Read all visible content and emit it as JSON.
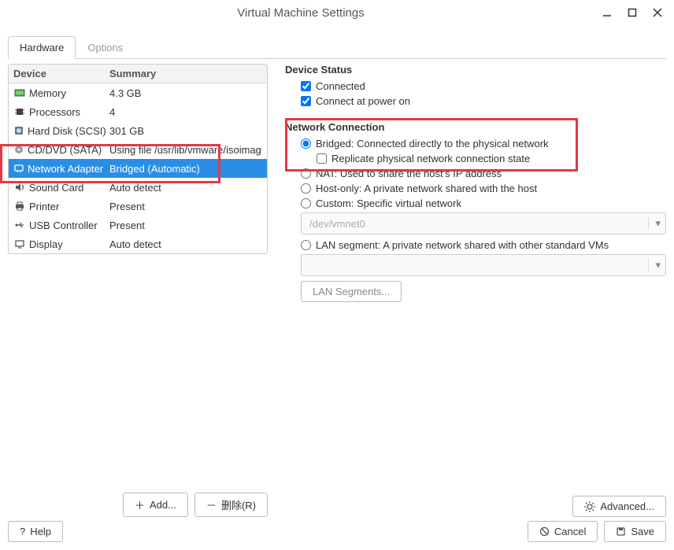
{
  "window": {
    "title": "Virtual Machine Settings"
  },
  "tabs": {
    "hardware": "Hardware",
    "options": "Options"
  },
  "columns": {
    "device": "Device",
    "summary": "Summary"
  },
  "devices": {
    "memory": {
      "name": "Memory",
      "summary": "4.3 GB"
    },
    "processors": {
      "name": "Processors",
      "summary": "4"
    },
    "harddisk": {
      "name": "Hard Disk (SCSI)",
      "summary": "301 GB"
    },
    "cddvd": {
      "name": "CD/DVD (SATA)",
      "summary": "Using file /usr/lib/vmware/isoimag"
    },
    "netadapter": {
      "name": "Network Adapter",
      "summary": "Bridged (Automatic)"
    },
    "soundcard": {
      "name": "Sound Card",
      "summary": "Auto detect"
    },
    "printer": {
      "name": "Printer",
      "summary": "Present"
    },
    "usb": {
      "name": "USB Controller",
      "summary": "Present"
    },
    "display": {
      "name": "Display",
      "summary": "Auto detect"
    }
  },
  "leftButtons": {
    "add": "Add...",
    "remove": "删除(R)"
  },
  "status": {
    "title": "Device Status",
    "connected": "Connected",
    "connectPowerOn": "Connect at power on"
  },
  "netconn": {
    "title": "Network Connection",
    "bridged": "Bridged: Connected directly to the physical network",
    "replicate": "Replicate physical network connection state",
    "nat": "NAT: Used to share the host's IP address",
    "hostonly": "Host-only: A private network shared with the host",
    "custom": "Custom: Specific virtual network",
    "customValue": "/dev/vmnet0",
    "lan": "LAN segment: A private network shared with other standard VMs",
    "lanSegmentsBtn": "LAN Segments..."
  },
  "rightButtons": {
    "advanced": "Advanced..."
  },
  "footer": {
    "help": "Help",
    "cancel": "Cancel",
    "save": "Save"
  }
}
